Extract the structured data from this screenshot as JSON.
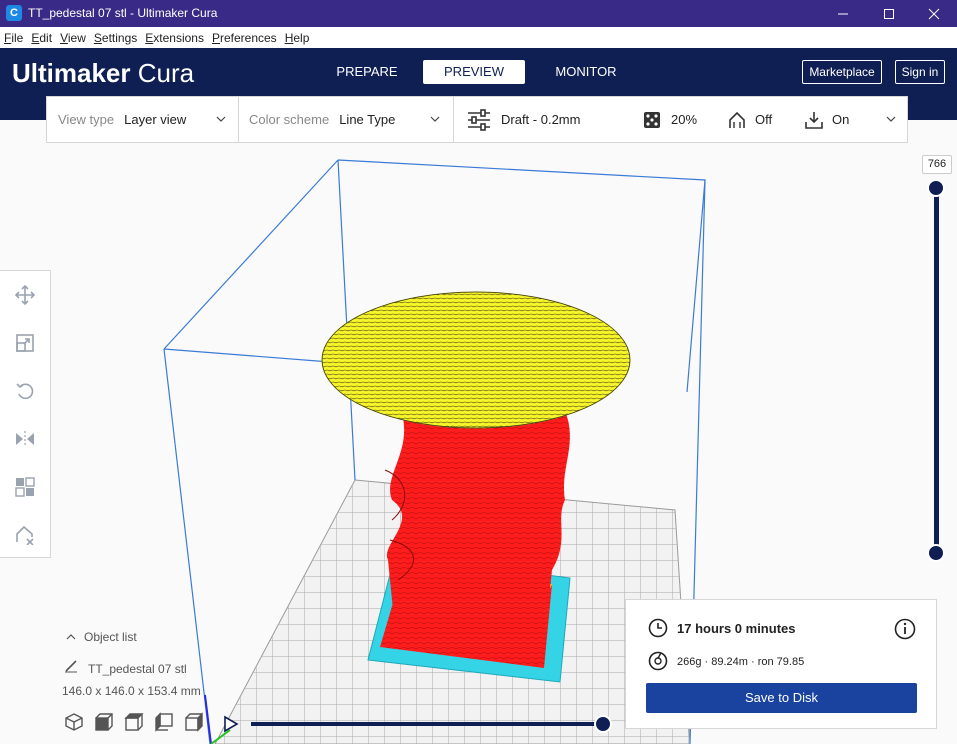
{
  "window": {
    "title": "TT_pedestal 07 stl - Ultimaker Cura",
    "app_icon_letter": "C"
  },
  "menu": [
    {
      "label": "File",
      "underline": "F",
      "rest": "ile"
    },
    {
      "label": "Edit",
      "underline": "E",
      "rest": "dit"
    },
    {
      "label": "View",
      "underline": "V",
      "rest": "iew"
    },
    {
      "label": "Settings",
      "underline": "S",
      "rest": "ettings"
    },
    {
      "label": "Extensions",
      "underline": "E",
      "rest": "xtensions"
    },
    {
      "label": "Preferences",
      "underline": "P",
      "rest": "references"
    },
    {
      "label": "Help",
      "underline": "H",
      "rest": "elp"
    }
  ],
  "header": {
    "logo_bold": "Ultimaker",
    "logo_light": "Cura",
    "tabs": {
      "prepare": "PREPARE",
      "preview": "PREVIEW",
      "monitor": "MONITOR"
    },
    "marketplace": "Marketplace",
    "signin": "Sign in"
  },
  "settings_bar": {
    "view_type_label": "View type",
    "view_type_value": "Layer view",
    "color_scheme_label": "Color scheme",
    "color_scheme_value": "Line Type",
    "profile": "Draft - 0.2mm",
    "infill": "20%",
    "support": "Off",
    "adhesion": "On"
  },
  "layer_slider": {
    "value": "766"
  },
  "object_panel": {
    "header": "Object list",
    "object_name": "TT_pedestal 07 stl",
    "dimensions": "146.0 x 146.0 x 153.4 mm"
  },
  "print_info": {
    "time": "17 hours 0 minutes",
    "material": "266g · 89.24m · ron 79.85",
    "save_label": "Save to Disk"
  },
  "colors": {
    "header_bg": "#0f1f54",
    "titlebar_bg": "#3a2a87",
    "accent": "#19439e",
    "build_volume": "#3a7bd5",
    "model_wall": "#ff1c1c",
    "model_top": "#f7f52a",
    "adhesion": "#35d3e6"
  }
}
